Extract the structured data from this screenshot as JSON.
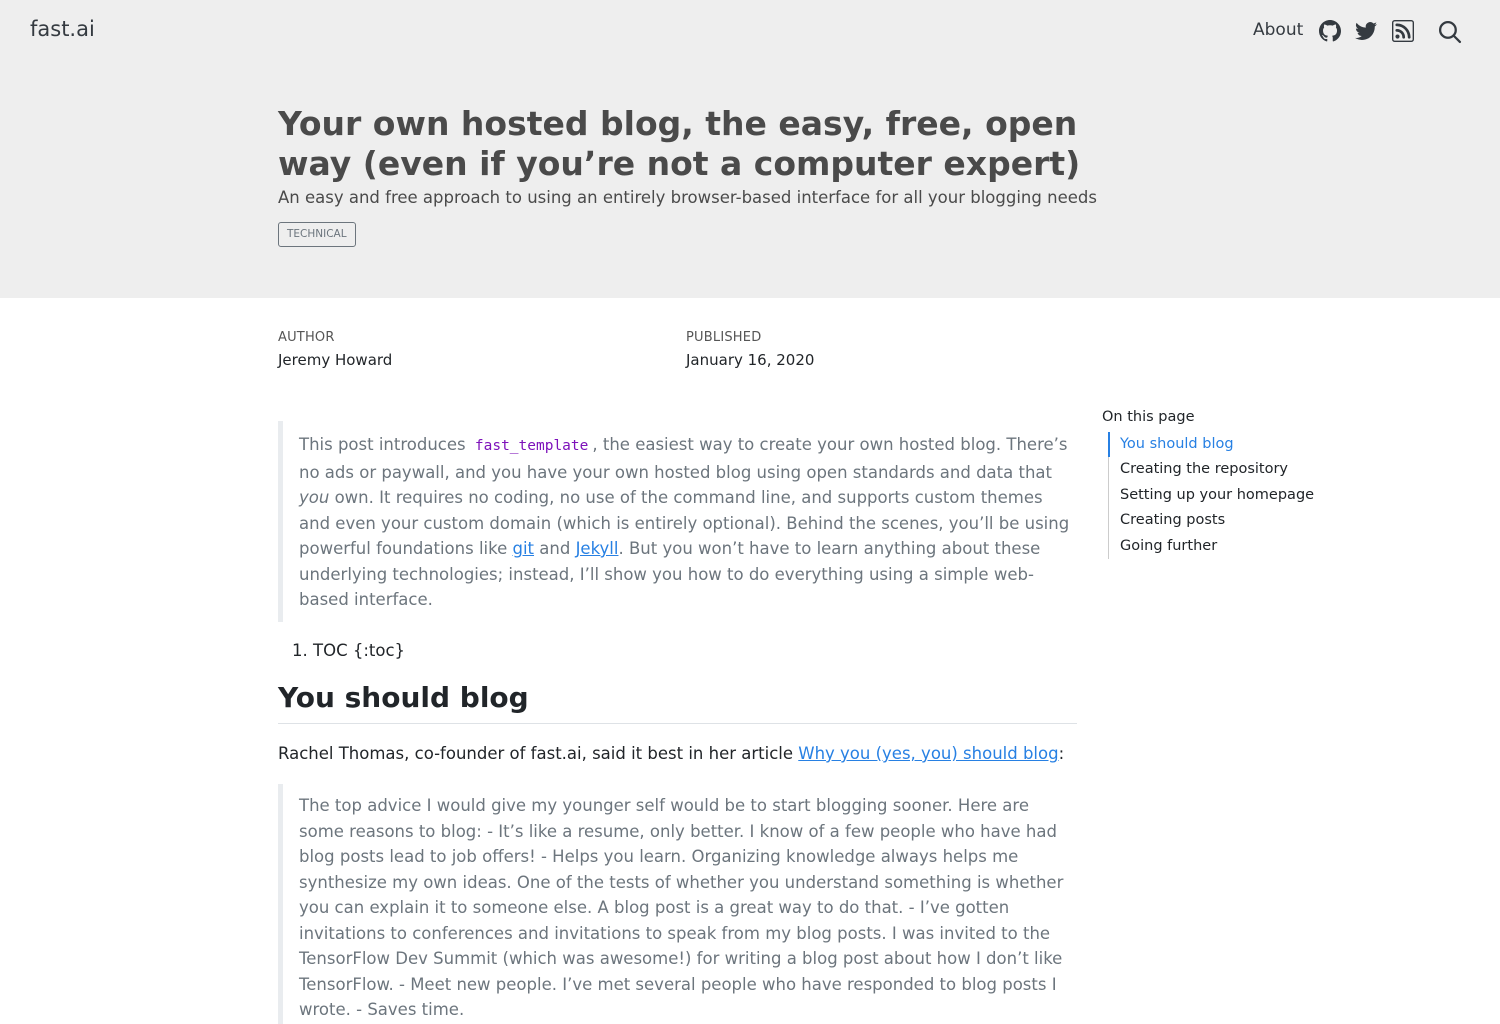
{
  "navbar": {
    "brand": "fast.ai",
    "about": "About",
    "icons": [
      "github-icon",
      "twitter-icon",
      "rss-icon",
      "search-icon"
    ]
  },
  "post": {
    "title": "Your own hosted blog, the easy, free, open way (even if you’re not a computer expert)",
    "subtitle": "An easy and free approach to using an entirely browser-based interface for all your blogging needs",
    "category": "TECHNICAL",
    "author_label": "AUTHOR",
    "author": "Jeremy Howard",
    "published_label": "PUBLISHED",
    "published": "January 16, 2020"
  },
  "toc": {
    "heading": "On this page",
    "items": [
      {
        "label": "You should blog",
        "active": true
      },
      {
        "label": "Creating the repository",
        "active": false
      },
      {
        "label": "Setting up your homepage",
        "active": false
      },
      {
        "label": "Creating posts",
        "active": false
      },
      {
        "label": "Going further",
        "active": false
      }
    ]
  },
  "intro": {
    "before_code": "This post introduces ",
    "code": "fast_template",
    "after_code": ", the easiest way to create your own hosted blog. There’s no ads or paywall, and you have your own hosted blog using open standards and data that ",
    "emphasis": "you",
    "after_emphasis": " own. It requires no coding, no use of the command line, and supports custom themes and even your custom domain (which is entirely optional). Behind the scenes, you’ll be using powerful foundations like ",
    "link_git": "git",
    "and": " and ",
    "link_jekyll": "Jekyll",
    "ending": ". But you won’t have to learn anything about these underlying technologies; instead, I’ll show you how to do everything using a simple web-based interface."
  },
  "toc_list_item": "TOC {:toc}",
  "section": {
    "heading": "You should blog",
    "para_before": "Rachel Thomas, co-founder of fast.ai, said it best in her article ",
    "para_link": "Why you (yes, you) should blog",
    "para_after": ":",
    "quote": "The top advice I would give my younger self would be to start blogging sooner. Here are some reasons to blog: - It’s like a resume, only better. I know of a few people who have had blog posts lead to job offers! - Helps you learn. Organizing knowledge always helps me synthesize my own ideas. One of the tests of whether you understand something is whether you can explain it to someone else. A blog post is a great way to do that. - I’ve gotten invitations to conferences and invitations to speak from my blog posts. I was invited to the TensorFlow Dev Summit (which was awesome!) for writing a blog post about how I don’t like TensorFlow. - Meet new people. I’ve met several people who have responded to blog posts I wrote. - Saves time."
  },
  "colors": {
    "link": "#2780e3",
    "banner_bg": "#eeeeee",
    "code": "#7d12ba"
  }
}
